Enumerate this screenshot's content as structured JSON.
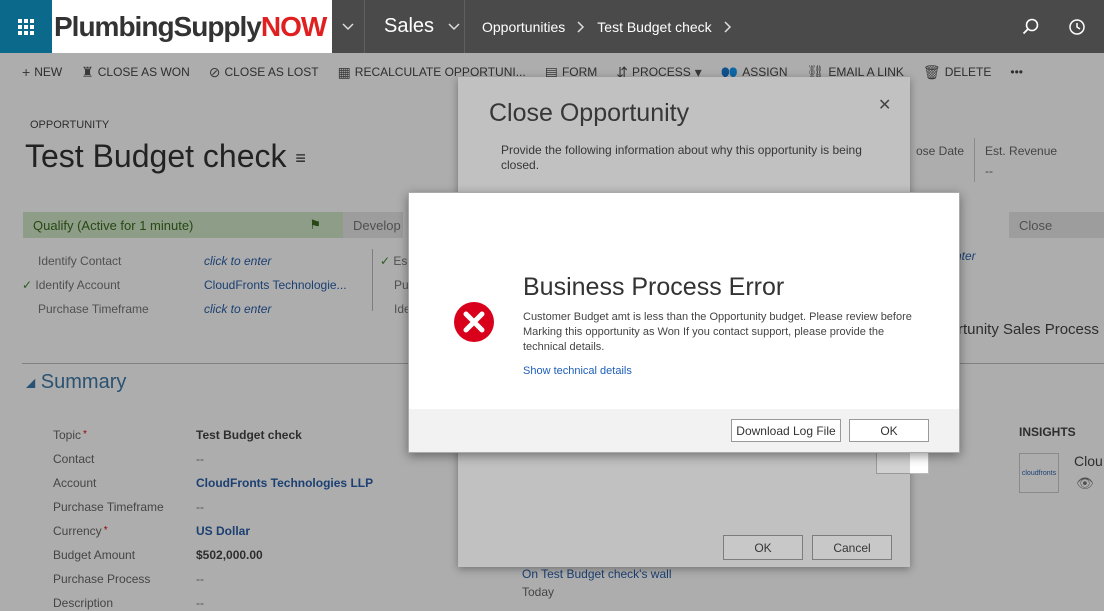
{
  "topnav": {
    "logo_part1": "PlumbingSupply",
    "logo_part2": "NOW",
    "area": "Sales",
    "breadcrumb": [
      "Opportunities",
      "Test Budget check"
    ]
  },
  "commands": {
    "new": "New",
    "close_won": "Close as Won",
    "close_lost": "Close as Lost",
    "recalculate": "Recalculate Opportuni...",
    "form": "Form",
    "process": "Process",
    "assign": "Assign",
    "email_link": "Email a Link",
    "delete": "Delete",
    "more": "•••"
  },
  "header": {
    "entity_type": "OPPORTUNITY",
    "title": "Test Budget check",
    "close_date_label": "ose Date",
    "est_revenue_label": "Est. Revenue",
    "est_revenue_value": "--"
  },
  "process": {
    "active_stage": "Qualify (Active for 1 minute)",
    "stage2": "Develop",
    "last_stage": "Close",
    "fields": [
      "Identify Contact",
      "Identify Account",
      "Purchase Timeframe"
    ],
    "values": [
      "click to enter",
      "CloudFronts Technologie...",
      "click to enter"
    ],
    "col2": [
      "Es",
      "Pu",
      "Ide"
    ],
    "right_enter": "nter",
    "process_name": "rtunity Sales Process"
  },
  "summary": {
    "title": "Summary",
    "labels": [
      "Topic",
      "Contact",
      "Account",
      "Purchase Timeframe",
      "Currency",
      "Budget Amount",
      "Purchase Process",
      "Description"
    ],
    "values": [
      "Test Budget check",
      "--",
      "CloudFronts Technologies LLP",
      "--",
      "US Dollar",
      "$502,000.00",
      "--",
      "--"
    ],
    "wall_link": "On Test Budget check's wall",
    "wall_today": "Today"
  },
  "insights": {
    "title": "INSIGHTS",
    "card_text": "cloudfronts",
    "name": "Clou"
  },
  "close_dialog": {
    "title": "Close Opportunity",
    "close_glyph": "✕",
    "description": "Provide the following information about why this opportunity is being closed.",
    "ok": "OK",
    "cancel": "Cancel"
  },
  "error_dialog": {
    "title": "Business Process Error",
    "message": "Customer Budget amt is less than the Opportunity budget. Please review before Marking this opportunity as Won If you contact support, please provide the technical details.",
    "link": "Show technical details",
    "download": "Download Log File",
    "ok": "OK",
    "icon_color": "#d9001b"
  }
}
